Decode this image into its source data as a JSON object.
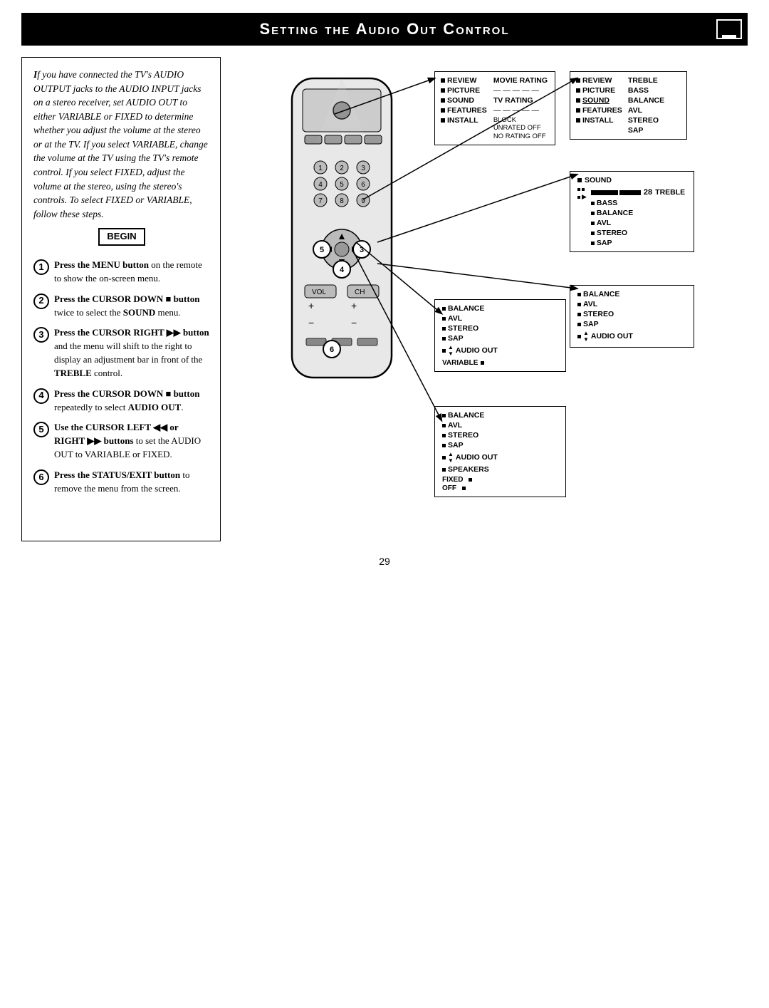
{
  "header": {
    "title": "Setting the Audio Out Control"
  },
  "intro_text": "If you have connected the TV's AUDIO OUTPUT jacks to the AUDIO INPUT jacks on a stereo receiver, set AUDIO OUT to either VARIABLE or FIXED to determine whether you adjust the volume at the stereo or at the TV. If you select VARIABLE, change the volume at the TV using the TV's remote control. If you select FIXED, adjust the volume at the stereo, using the stereo's controls. To select FIXED or VARIABLE, follow these steps.",
  "begin_label": "BEGIN",
  "steps": [
    {
      "num": "1",
      "text": "Press the MENU button on the remote to show the on-screen menu."
    },
    {
      "num": "2",
      "text": "Press the CURSOR DOWN ■ button twice to select the SOUND menu."
    },
    {
      "num": "3",
      "text": "Press the CURSOR RIGHT ▶▶ button and the menu will shift to the right to display an adjustment bar in front of the TREBLE control."
    },
    {
      "num": "4",
      "text": "Press the CURSOR DOWN ■ button repeatedly to select AUDIO OUT."
    },
    {
      "num": "5",
      "text": "Use the CURSOR LEFT ◀◀ or RIGHT ▶▶ buttons to set the AUDIO OUT to VARIABLE or FIXED."
    },
    {
      "num": "6",
      "text": "Press the STATUS/EXIT button to remove the menu from the screen."
    }
  ],
  "menus": {
    "menu1_left": {
      "items": [
        "REVIEW",
        "PICTURE",
        "SOUND",
        "FEATURES",
        "INSTALL"
      ],
      "right_items": [
        "MOVIE RATING",
        "------",
        "TV RATING",
        "------",
        "BLOCK UNRATED  OFF",
        "NO RATING       OFF"
      ]
    },
    "menu2_left": {
      "items": [
        "REVIEW",
        "PICTURE",
        "SOUND",
        "FEATURES",
        "INSTALL"
      ],
      "right_items": [
        "TREBLE",
        "BASS",
        "BALANCE",
        "AVL",
        "STEREO",
        "SAP"
      ]
    },
    "menu3": {
      "label": "SOUND",
      "value": "28",
      "items": [
        "TREBLE",
        "BASS",
        "BALANCE",
        "AVL",
        "STEREO",
        "SAP"
      ]
    },
    "menu4": {
      "items": [
        "BALANCE",
        "AVL",
        "STEREO",
        "SAP",
        "AUDIO OUT"
      ]
    },
    "menu5_variable": {
      "label": "VARIABLE",
      "items": [
        "BALANCE",
        "AVL",
        "STEREO",
        "SAP",
        "AUDIO OUT"
      ]
    },
    "menu6_fixed": {
      "label": "FIXED",
      "off_label": "OFF",
      "items": [
        "BALANCE",
        "AVL",
        "STEREO",
        "SAP",
        "AUDIO OUT",
        "SPEAKERS"
      ]
    }
  },
  "page_number": "29"
}
